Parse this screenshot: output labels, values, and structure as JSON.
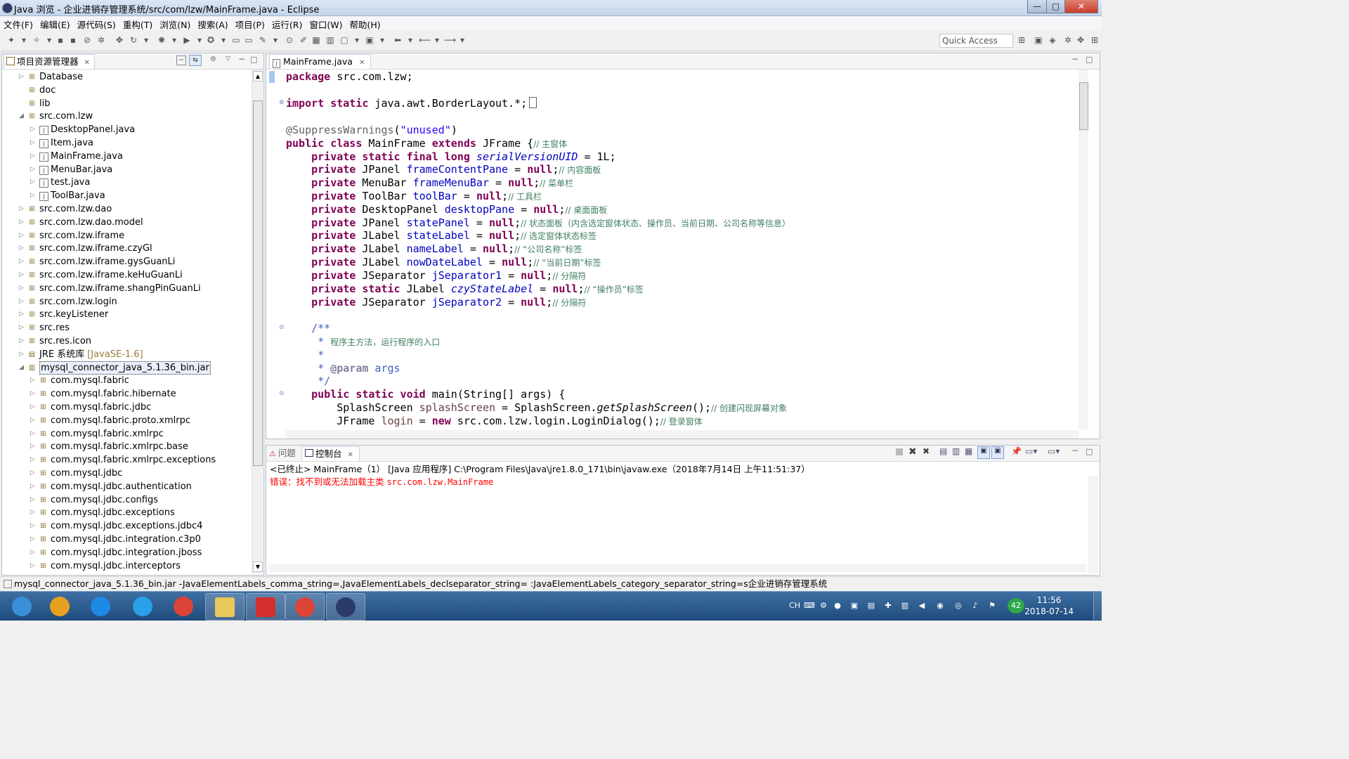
{
  "window": {
    "title": "Java 浏览 - 企业进销存管理系统/src/com/lzw/MainFrame.java - Eclipse",
    "min_glyph": "—",
    "max_glyph": "□",
    "close_glyph": "✕"
  },
  "menu": [
    "文件(F)",
    "编辑(E)",
    "源代码(S)",
    "重构(T)",
    "浏览(N)",
    "搜索(A)",
    "项目(P)",
    "运行(R)",
    "窗口(W)",
    "帮助(H)"
  ],
  "toolbar": {
    "quick_access_placeholder": "Quick Access"
  },
  "explorer": {
    "tab_label": "项目资源管理器",
    "close_glyph": "✕",
    "items": [
      {
        "label": "Database",
        "indent": 1,
        "expanded": false,
        "icon": "folder-icon"
      },
      {
        "label": "doc",
        "indent": 1,
        "expanded": null,
        "icon": "folder-icon"
      },
      {
        "label": "lib",
        "indent": 1,
        "expanded": null,
        "icon": "folder-icon"
      },
      {
        "label": "src.com.lzw",
        "indent": 1,
        "expanded": true,
        "icon": "package-icon"
      },
      {
        "label": "DesktopPanel.java",
        "indent": 2,
        "expanded": false,
        "icon": "java-file-icon"
      },
      {
        "label": "Item.java",
        "indent": 2,
        "expanded": false,
        "icon": "java-file-icon"
      },
      {
        "label": "MainFrame.java",
        "indent": 2,
        "expanded": false,
        "icon": "java-file-icon"
      },
      {
        "label": "MenuBar.java",
        "indent": 2,
        "expanded": false,
        "icon": "java-file-icon"
      },
      {
        "label": "test.java",
        "indent": 2,
        "expanded": false,
        "icon": "java-file-icon"
      },
      {
        "label": "ToolBar.java",
        "indent": 2,
        "expanded": false,
        "icon": "java-file-icon"
      },
      {
        "label": "src.com.lzw.dao",
        "indent": 1,
        "expanded": false,
        "icon": "package-icon"
      },
      {
        "label": "src.com.lzw.dao.model",
        "indent": 1,
        "expanded": false,
        "icon": "package-icon"
      },
      {
        "label": "src.com.lzw.iframe",
        "indent": 1,
        "expanded": false,
        "icon": "package-icon"
      },
      {
        "label": "src.com.lzw.iframe.czyGl",
        "indent": 1,
        "expanded": false,
        "icon": "package-icon"
      },
      {
        "label": "src.com.lzw.iframe.gysGuanLi",
        "indent": 1,
        "expanded": false,
        "icon": "package-icon"
      },
      {
        "label": "src.com.lzw.iframe.keHuGuanLi",
        "indent": 1,
        "expanded": false,
        "icon": "package-icon"
      },
      {
        "label": "src.com.lzw.iframe.shangPinGuanLi",
        "indent": 1,
        "expanded": false,
        "icon": "package-icon"
      },
      {
        "label": "src.com.lzw.login",
        "indent": 1,
        "expanded": false,
        "icon": "package-icon"
      },
      {
        "label": "src.keyListener",
        "indent": 1,
        "expanded": false,
        "icon": "package-icon"
      },
      {
        "label": "src.res",
        "indent": 1,
        "expanded": false,
        "icon": "folder-icon"
      },
      {
        "label": "src.res.icon",
        "indent": 1,
        "expanded": false,
        "icon": "package-icon"
      },
      {
        "label": "JRE 系统库",
        "suffix": "[JavaSE-1.6]",
        "indent": 1,
        "expanded": false,
        "icon": "library-icon"
      },
      {
        "label": "mysql_connector_java_5.1.36_bin.jar",
        "indent": 1,
        "expanded": true,
        "icon": "jar-icon",
        "selected": true
      },
      {
        "label": "com.mysql.fabric",
        "indent": 2,
        "expanded": false,
        "icon": "package-icon"
      },
      {
        "label": "com.mysql.fabric.hibernate",
        "indent": 2,
        "expanded": false,
        "icon": "package-icon"
      },
      {
        "label": "com.mysql.fabric.jdbc",
        "indent": 2,
        "expanded": false,
        "icon": "package-icon"
      },
      {
        "label": "com.mysql.fabric.proto.xmlrpc",
        "indent": 2,
        "expanded": false,
        "icon": "package-icon"
      },
      {
        "label": "com.mysql.fabric.xmlrpc",
        "indent": 2,
        "expanded": false,
        "icon": "package-icon"
      },
      {
        "label": "com.mysql.fabric.xmlrpc.base",
        "indent": 2,
        "expanded": false,
        "icon": "package-icon"
      },
      {
        "label": "com.mysql.fabric.xmlrpc.exceptions",
        "indent": 2,
        "expanded": false,
        "icon": "package-icon"
      },
      {
        "label": "com.mysql.jdbc",
        "indent": 2,
        "expanded": false,
        "icon": "package-icon"
      },
      {
        "label": "com.mysql.jdbc.authentication",
        "indent": 2,
        "expanded": false,
        "icon": "package-icon"
      },
      {
        "label": "com.mysql.jdbc.configs",
        "indent": 2,
        "expanded": false,
        "icon": "folder-icon"
      },
      {
        "label": "com.mysql.jdbc.exceptions",
        "indent": 2,
        "expanded": false,
        "icon": "package-icon"
      },
      {
        "label": "com.mysql.jdbc.exceptions.jdbc4",
        "indent": 2,
        "expanded": false,
        "icon": "package-icon"
      },
      {
        "label": "com.mysql.jdbc.integration.c3p0",
        "indent": 2,
        "expanded": false,
        "icon": "package-icon"
      },
      {
        "label": "com.mysql.jdbc.integration.jboss",
        "indent": 2,
        "expanded": false,
        "icon": "package-icon"
      },
      {
        "label": "com.mysql.jdbc.interceptors",
        "indent": 2,
        "expanded": false,
        "icon": "package-icon"
      }
    ]
  },
  "editor": {
    "tab_label": "MainFrame.java",
    "close_glyph": "✕",
    "lines": [
      [
        [
          "kw",
          "package"
        ],
        [
          "t",
          " src.com.lzw;"
        ]
      ],
      [],
      [
        [
          "kw",
          "import static"
        ],
        [
          "t",
          " java.awt.BorderLayout.*;"
        ]
      ],
      [],
      [
        [
          "ann",
          "@SuppressWarnings"
        ],
        [
          "t",
          "("
        ],
        [
          "str",
          "\"unused\""
        ],
        [
          "t",
          ")"
        ]
      ],
      [
        [
          "kw",
          "public class"
        ],
        [
          "t",
          " MainFrame "
        ],
        [
          "kw",
          "extends"
        ],
        [
          "t",
          " JFrame {"
        ],
        [
          "cm",
          "// 主窗体"
        ]
      ],
      [
        [
          "t",
          "    "
        ],
        [
          "kw",
          "private static final long"
        ],
        [
          "t",
          " "
        ],
        [
          "sfld",
          "serialVersionUID"
        ],
        [
          "t",
          " = 1L;"
        ]
      ],
      [
        [
          "t",
          "    "
        ],
        [
          "kw",
          "private"
        ],
        [
          "t",
          " JPanel "
        ],
        [
          "fld",
          "frameContentPane"
        ],
        [
          "t",
          " = "
        ],
        [
          "kw",
          "null"
        ],
        [
          "t",
          ";"
        ],
        [
          "cm",
          "// 内容面板"
        ]
      ],
      [
        [
          "t",
          "    "
        ],
        [
          "kw",
          "private"
        ],
        [
          "t",
          " MenuBar "
        ],
        [
          "fld",
          "frameMenuBar"
        ],
        [
          "t",
          " = "
        ],
        [
          "kw",
          "null"
        ],
        [
          "t",
          ";"
        ],
        [
          "cm",
          "// 菜单栏"
        ]
      ],
      [
        [
          "t",
          "    "
        ],
        [
          "kw",
          "private"
        ],
        [
          "t",
          " ToolBar "
        ],
        [
          "fld",
          "toolBar"
        ],
        [
          "t",
          " = "
        ],
        [
          "kw",
          "null"
        ],
        [
          "t",
          ";"
        ],
        [
          "cm",
          "// 工具栏"
        ]
      ],
      [
        [
          "t",
          "    "
        ],
        [
          "kw",
          "private"
        ],
        [
          "t",
          " DesktopPanel "
        ],
        [
          "fld",
          "desktopPane"
        ],
        [
          "t",
          " = "
        ],
        [
          "kw",
          "null"
        ],
        [
          "t",
          ";"
        ],
        [
          "cm",
          "// 桌面面板"
        ]
      ],
      [
        [
          "t",
          "    "
        ],
        [
          "kw",
          "private"
        ],
        [
          "t",
          " JPanel "
        ],
        [
          "fld",
          "statePanel"
        ],
        [
          "t",
          " = "
        ],
        [
          "kw",
          "null"
        ],
        [
          "t",
          ";"
        ],
        [
          "cm",
          "// 状态面板（内含选定窗体状态、操作员、当前日期、公司名称等信息）"
        ]
      ],
      [
        [
          "t",
          "    "
        ],
        [
          "kw",
          "private"
        ],
        [
          "t",
          " JLabel "
        ],
        [
          "fld",
          "stateLabel"
        ],
        [
          "t",
          " = "
        ],
        [
          "kw",
          "null"
        ],
        [
          "t",
          ";"
        ],
        [
          "cm",
          "// 选定窗体状态标签"
        ]
      ],
      [
        [
          "t",
          "    "
        ],
        [
          "kw",
          "private"
        ],
        [
          "t",
          " JLabel "
        ],
        [
          "fld",
          "nameLabel"
        ],
        [
          "t",
          " = "
        ],
        [
          "kw",
          "null"
        ],
        [
          "t",
          ";"
        ],
        [
          "cm",
          "// “公司名称”标签"
        ]
      ],
      [
        [
          "t",
          "    "
        ],
        [
          "kw",
          "private"
        ],
        [
          "t",
          " JLabel "
        ],
        [
          "fld",
          "nowDateLabel"
        ],
        [
          "t",
          " = "
        ],
        [
          "kw",
          "null"
        ],
        [
          "t",
          ";"
        ],
        [
          "cm",
          "// “当前日期”标签"
        ]
      ],
      [
        [
          "t",
          "    "
        ],
        [
          "kw",
          "private"
        ],
        [
          "t",
          " JSeparator "
        ],
        [
          "fld",
          "jSeparator1"
        ],
        [
          "t",
          " = "
        ],
        [
          "kw",
          "null"
        ],
        [
          "t",
          ";"
        ],
        [
          "cm",
          "// 分隔符"
        ]
      ],
      [
        [
          "t",
          "    "
        ],
        [
          "kw",
          "private static"
        ],
        [
          "t",
          " JLabel "
        ],
        [
          "sfld",
          "czyStateLabel"
        ],
        [
          "t",
          " = "
        ],
        [
          "kw",
          "null"
        ],
        [
          "t",
          ";"
        ],
        [
          "cm",
          "// “操作员”标签"
        ]
      ],
      [
        [
          "t",
          "    "
        ],
        [
          "kw",
          "private"
        ],
        [
          "t",
          " JSeparator "
        ],
        [
          "fld",
          "jSeparator2"
        ],
        [
          "t",
          " = "
        ],
        [
          "kw",
          "null"
        ],
        [
          "t",
          ";"
        ],
        [
          "cm",
          "// 分隔符"
        ]
      ],
      [],
      [
        [
          "t",
          "    "
        ],
        [
          "jd",
          "/**"
        ]
      ],
      [
        [
          "t",
          "     "
        ],
        [
          "jd",
          "* "
        ],
        [
          "cm",
          "程序主方法，运行程序的入口"
        ]
      ],
      [
        [
          "t",
          "     "
        ],
        [
          "jd",
          "*"
        ]
      ],
      [
        [
          "t",
          "     "
        ],
        [
          "jd",
          "* "
        ],
        [
          "jdtag",
          "@param"
        ],
        [
          "jd",
          " args"
        ]
      ],
      [
        [
          "t",
          "     "
        ],
        [
          "jd",
          "*/"
        ]
      ],
      [
        [
          "t",
          "    "
        ],
        [
          "kw",
          "public static void"
        ],
        [
          "t",
          " main(String[] args) {"
        ]
      ],
      [
        [
          "t",
          "        SplashScreen "
        ],
        [
          "fldp",
          "splashScreen"
        ],
        [
          "t",
          " = SplashScreen."
        ],
        [
          "mth",
          "getSplashScreen"
        ],
        [
          "t",
          "();"
        ],
        [
          "cm",
          "// 创建闪现屏幕对象"
        ]
      ],
      [
        [
          "t",
          "        JFrame "
        ],
        [
          "fldp",
          "login"
        ],
        [
          "t",
          " = "
        ],
        [
          "kw",
          "new"
        ],
        [
          "t",
          " src.com.lzw.login.LoginDialog();"
        ],
        [
          "cm",
          "// 登录窗体"
        ]
      ]
    ]
  },
  "console": {
    "tab_problems": "问题",
    "tab_console": "控制台",
    "close_glyph": "✕",
    "header": "<已终止> MainFrame（1） [Java 应用程序] C:\\Program Files\\Java\\jre1.8.0_171\\bin\\javaw.exe（2018年7月14日 上午11:51:37）",
    "error_prefix": "错误：找不到或无法加载主类 ",
    "error_class": "src.com.lzw.MainFrame",
    "error_color": "#ff0000"
  },
  "status_bar": {
    "text": "mysql_connector_java_5.1.36_bin.jar -JavaElementLabels_comma_string=,JavaElementLabels_declseparator_string= :JavaElementLabels_category_separator_string=s企业进销存管理系统"
  },
  "taskbar": {
    "apps": [
      {
        "name": "start-button",
        "color": "#3b8fd6"
      },
      {
        "name": "app-colorful-icon",
        "color": "#e8a020"
      },
      {
        "name": "ie-blue-icon",
        "color": "#1e88e5"
      },
      {
        "name": "ie-icon",
        "color": "#2aa0e8"
      },
      {
        "name": "chrome-icon",
        "color": "#db4437"
      },
      {
        "name": "folder-icon",
        "color": "#e8c85a"
      },
      {
        "name": "pdf-icon",
        "color": "#d32f2f"
      },
      {
        "name": "chrome-icon",
        "color": "#db4437"
      },
      {
        "name": "eclipse-icon",
        "color": "#2c3a6b"
      }
    ],
    "tray_lang": "CH",
    "tray_badge": "42",
    "time": "11:56",
    "date": "2018-07-14"
  }
}
